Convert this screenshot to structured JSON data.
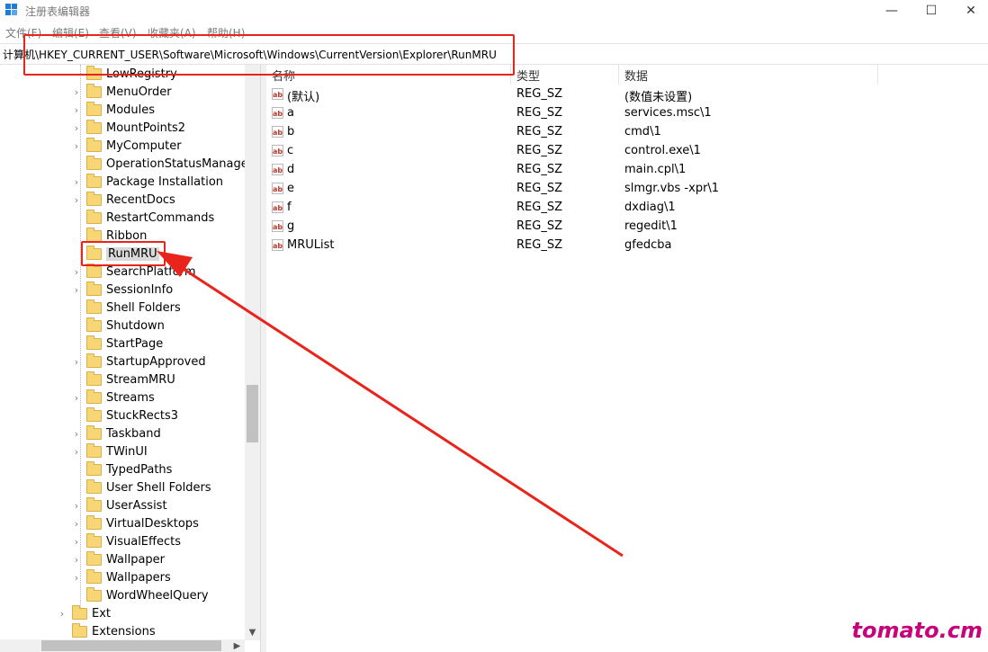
{
  "window": {
    "title": "注册表编辑器",
    "icon": "registry-editor-icon",
    "minimize": "—",
    "maximize": "☐",
    "close": "✕"
  },
  "menu": [
    {
      "label": "文件(F)"
    },
    {
      "label": "编辑(E)"
    },
    {
      "label": "查看(V)"
    },
    {
      "label": "收藏夹(A)"
    },
    {
      "label": "帮助(H)"
    }
  ],
  "address": {
    "path": "计算机\\HKEY_CURRENT_USER\\Software\\Microsoft\\Windows\\CurrentVersion\\Explorer\\RunMRU"
  },
  "tree": {
    "items": [
      {
        "label": "LowRegistry",
        "expandable": false,
        "selected": false
      },
      {
        "label": "MenuOrder",
        "expandable": true,
        "selected": false
      },
      {
        "label": "Modules",
        "expandable": true,
        "selected": false
      },
      {
        "label": "MountPoints2",
        "expandable": true,
        "selected": false
      },
      {
        "label": "MyComputer",
        "expandable": true,
        "selected": false
      },
      {
        "label": "OperationStatusManager",
        "expandable": false,
        "selected": false
      },
      {
        "label": "Package Installation",
        "expandable": true,
        "selected": false
      },
      {
        "label": "RecentDocs",
        "expandable": true,
        "selected": false
      },
      {
        "label": "RestartCommands",
        "expandable": false,
        "selected": false
      },
      {
        "label": "Ribbon",
        "expandable": false,
        "selected": false
      },
      {
        "label": "RunMRU",
        "expandable": false,
        "selected": true
      },
      {
        "label": "SearchPlatform",
        "expandable": true,
        "selected": false
      },
      {
        "label": "SessionInfo",
        "expandable": true,
        "selected": false
      },
      {
        "label": "Shell Folders",
        "expandable": false,
        "selected": false
      },
      {
        "label": "Shutdown",
        "expandable": false,
        "selected": false
      },
      {
        "label": "StartPage",
        "expandable": false,
        "selected": false
      },
      {
        "label": "StartupApproved",
        "expandable": true,
        "selected": false
      },
      {
        "label": "StreamMRU",
        "expandable": false,
        "selected": false
      },
      {
        "label": "Streams",
        "expandable": true,
        "selected": false
      },
      {
        "label": "StuckRects3",
        "expandable": false,
        "selected": false
      },
      {
        "label": "Taskband",
        "expandable": true,
        "selected": false
      },
      {
        "label": "TWinUI",
        "expandable": true,
        "selected": false
      },
      {
        "label": "TypedPaths",
        "expandable": false,
        "selected": false
      },
      {
        "label": "User Shell Folders",
        "expandable": false,
        "selected": false
      },
      {
        "label": "UserAssist",
        "expandable": true,
        "selected": false
      },
      {
        "label": "VirtualDesktops",
        "expandable": true,
        "selected": false
      },
      {
        "label": "VisualEffects",
        "expandable": true,
        "selected": false
      },
      {
        "label": "Wallpaper",
        "expandable": true,
        "selected": false
      },
      {
        "label": "Wallpapers",
        "expandable": true,
        "selected": false
      },
      {
        "label": "WordWheelQuery",
        "expandable": false,
        "selected": false
      }
    ],
    "parent_items": [
      {
        "label": "Ext",
        "expandable": true
      },
      {
        "label": "Extensions",
        "expandable": false
      }
    ]
  },
  "list": {
    "headers": {
      "name": "名称",
      "type": "类型",
      "data": "数据"
    },
    "rows": [
      {
        "name": "(默认)",
        "type": "REG_SZ",
        "data": "(数值未设置)"
      },
      {
        "name": "a",
        "type": "REG_SZ",
        "data": "services.msc\\1"
      },
      {
        "name": "b",
        "type": "REG_SZ",
        "data": "cmd\\1"
      },
      {
        "name": "c",
        "type": "REG_SZ",
        "data": "control.exe\\1"
      },
      {
        "name": "d",
        "type": "REG_SZ",
        "data": "main.cpl\\1"
      },
      {
        "name": "e",
        "type": "REG_SZ",
        "data": "slmgr.vbs -xpr\\1"
      },
      {
        "name": "f",
        "type": "REG_SZ",
        "data": "dxdiag\\1"
      },
      {
        "name": "g",
        "type": "REG_SZ",
        "data": "regedit\\1"
      },
      {
        "name": "MRUList",
        "type": "REG_SZ",
        "data": "gfedcba"
      }
    ]
  },
  "annotation": {
    "color": "#e8241b"
  },
  "watermark": {
    "text": "tomato.cm",
    "color": "#c8007a"
  }
}
